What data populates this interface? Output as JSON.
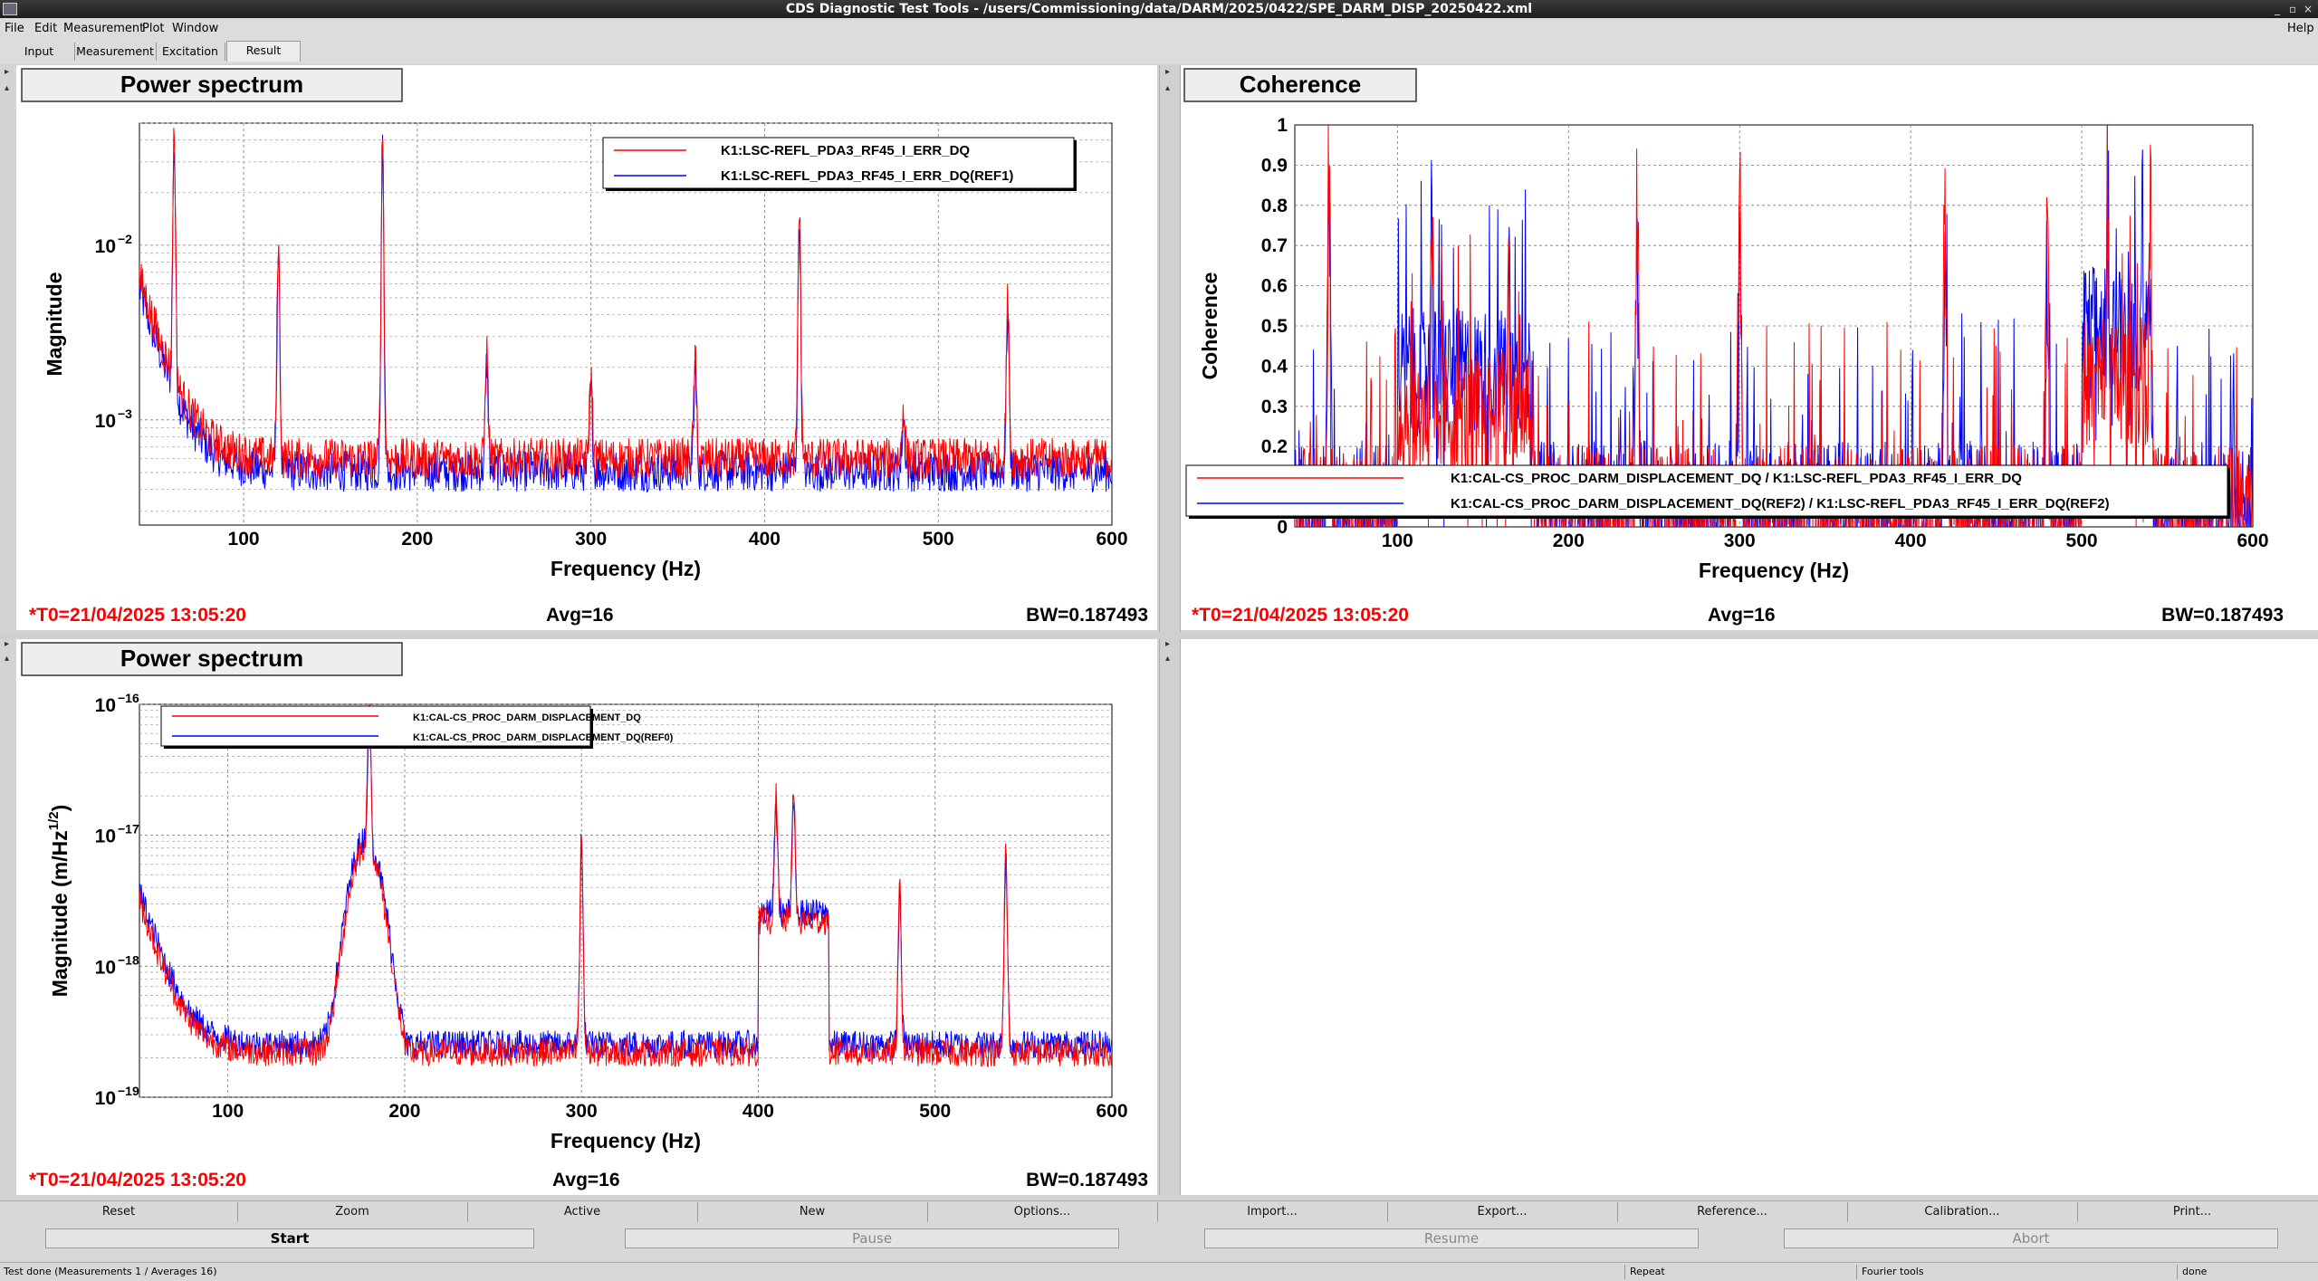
{
  "window": {
    "title": "CDS Diagnostic Test Tools - /users/Commissioning/data/DARM/2025/0422/SPE_DARM_DISP_20250422.xml",
    "help": "Help"
  },
  "menu": [
    "File",
    "Edit",
    "Measurement",
    "Plot",
    "Window"
  ],
  "tabs": [
    "Input",
    "Measurement",
    "Excitation",
    "Result"
  ],
  "active_tab": "Result",
  "colors": {
    "red": "#ff0000",
    "blue": "#0000ff",
    "accent_text": "#ff0000"
  },
  "panels": [
    {
      "title": "Power spectrum",
      "t0": "*T0=21/04/2025 13:05:20",
      "avg": "Avg=16",
      "bw": "BW=0.187493",
      "ylabel": "Magnitude",
      "xlabel": "Frequency (Hz)",
      "legend": [
        "K1:LSC-REFL_PDA3_RF45_I_ERR_DQ",
        "K1:LSC-REFL_PDA3_RF45_I_ERR_DQ(REF1)"
      ],
      "xticks": [
        "100",
        "200",
        "300",
        "400",
        "500",
        "600"
      ],
      "yticks": [
        "10",
        "10"
      ],
      "yexp": [
        "−2",
        "−3"
      ]
    },
    {
      "title": "Coherence",
      "t0": "*T0=21/04/2025 13:05:20",
      "avg": "Avg=16",
      "bw": "BW=0.187493",
      "ylabel": "Coherence",
      "xlabel": "Frequency (Hz)",
      "legend": [
        "K1:CAL-CS_PROC_DARM_DISPLACEMENT_DQ / K1:LSC-REFL_PDA3_RF45_I_ERR_DQ",
        "K1:CAL-CS_PROC_DARM_DISPLACEMENT_DQ(REF2) / K1:LSC-REFL_PDA3_RF45_I_ERR_DQ(REF2)"
      ],
      "xticks": [
        "100",
        "200",
        "300",
        "400",
        "500",
        "600"
      ],
      "yticks": [
        "1",
        "0.9",
        "0.8",
        "0.7",
        "0.6",
        "0.5",
        "0.4",
        "0.3",
        "0.2",
        "0"
      ]
    },
    {
      "title": "Power spectrum",
      "t0": "*T0=21/04/2025 13:05:20",
      "avg": "Avg=16",
      "bw": "BW=0.187493",
      "ylabel": "Magnitude (m/Hz",
      "ylabel_sup": "1/2",
      "ylabel_end": ")",
      "xlabel": "Frequency (Hz)",
      "legend": [
        "K1:CAL-CS_PROC_DARM_DISPLACEMENT_DQ",
        "K1:CAL-CS_PROC_DARM_DISPLACEMENT_DQ(REF0)"
      ],
      "xticks": [
        "100",
        "200",
        "300",
        "400",
        "500",
        "600"
      ],
      "yticks": [
        "10",
        "10",
        "10",
        "10"
      ],
      "yexp": [
        "−16",
        "−17",
        "−18",
        "−19"
      ]
    }
  ],
  "chart_data": [
    {
      "type": "line",
      "title": "Power spectrum",
      "xlabel": "Frequency (Hz)",
      "ylabel": "Magnitude",
      "yscale": "log",
      "xlim": [
        40,
        600
      ],
      "ylim": [
        0.00025,
        0.05
      ],
      "grid": true,
      "legend_position": "top-right",
      "series": [
        {
          "name": "K1:LSC-REFL_PDA3_RF45_I_ERR_DQ",
          "color": "#ff0000"
        },
        {
          "name": "K1:LSC-REFL_PDA3_RF45_I_ERR_DQ(REF1)",
          "color": "#0000ff"
        }
      ],
      "peaks": [
        [
          60,
          0.045
        ],
        [
          120,
          0.0105
        ],
        [
          180,
          0.045
        ],
        [
          240,
          0.0025
        ],
        [
          300,
          0.0018
        ],
        [
          360,
          0.0022
        ],
        [
          420,
          0.017
        ],
        [
          480,
          0.0012
        ],
        [
          540,
          0.0048
        ]
      ]
    },
    {
      "type": "line",
      "title": "Coherence",
      "xlabel": "Frequency (Hz)",
      "ylabel": "Coherence",
      "xlim": [
        40,
        600
      ],
      "ylim": [
        0,
        1
      ],
      "grid": true,
      "legend_position": "bottom",
      "series": [
        {
          "name": "K1:CAL-CS_PROC_DARM_DISPLACEMENT_DQ / K1:LSC-REFL_PDA3_RF45_I_ERR_DQ",
          "color": "#ff0000"
        },
        {
          "name": "K1:CAL-CS_PROC_DARM_DISPLACEMENT_DQ(REF2) / K1:LSC-REFL_PDA3_RF45_I_ERR_DQ(REF2)",
          "color": "#0000ff"
        }
      ],
      "peaks": [
        [
          60,
          1.0
        ],
        [
          120,
          0.95
        ],
        [
          165,
          0.92
        ],
        [
          240,
          0.96
        ],
        [
          300,
          1.0
        ],
        [
          420,
          0.97
        ],
        [
          480,
          0.95
        ],
        [
          515,
          0.88
        ],
        [
          540,
          0.92
        ]
      ]
    },
    {
      "type": "line",
      "title": "Power spectrum",
      "xlabel": "Frequency (Hz)",
      "ylabel": "Magnitude (m/Hz^1/2)",
      "yscale": "log",
      "xlim": [
        50,
        600
      ],
      "ylim": [
        1e-19,
        1e-16
      ],
      "grid": true,
      "legend_position": "top-left",
      "series": [
        {
          "name": "K1:CAL-CS_PROC_DARM_DISPLACEMENT_DQ",
          "color": "#ff0000"
        },
        {
          "name": "K1:CAL-CS_PROC_DARM_DISPLACEMENT_DQ(REF0)",
          "color": "#0000ff"
        }
      ],
      "peaks": [
        [
          180,
          1e-16
        ],
        [
          300,
          1e-17
        ],
        [
          410,
          2e-17
        ],
        [
          420,
          2e-17
        ],
        [
          480,
          4e-18
        ],
        [
          540,
          8e-18
        ]
      ]
    }
  ],
  "buttons": [
    "Reset",
    "Zoom",
    "Active",
    "New",
    "Options...",
    "Import...",
    "Export...",
    "Reference...",
    "Calibration...",
    "Print..."
  ],
  "controls": [
    "Start",
    "Pause",
    "Resume",
    "Abort"
  ],
  "status": {
    "left": "Test done (Measurements 1 / Averages 16)",
    "repeat": "Repeat",
    "fourier": "Fourier tools",
    "done": "done"
  }
}
